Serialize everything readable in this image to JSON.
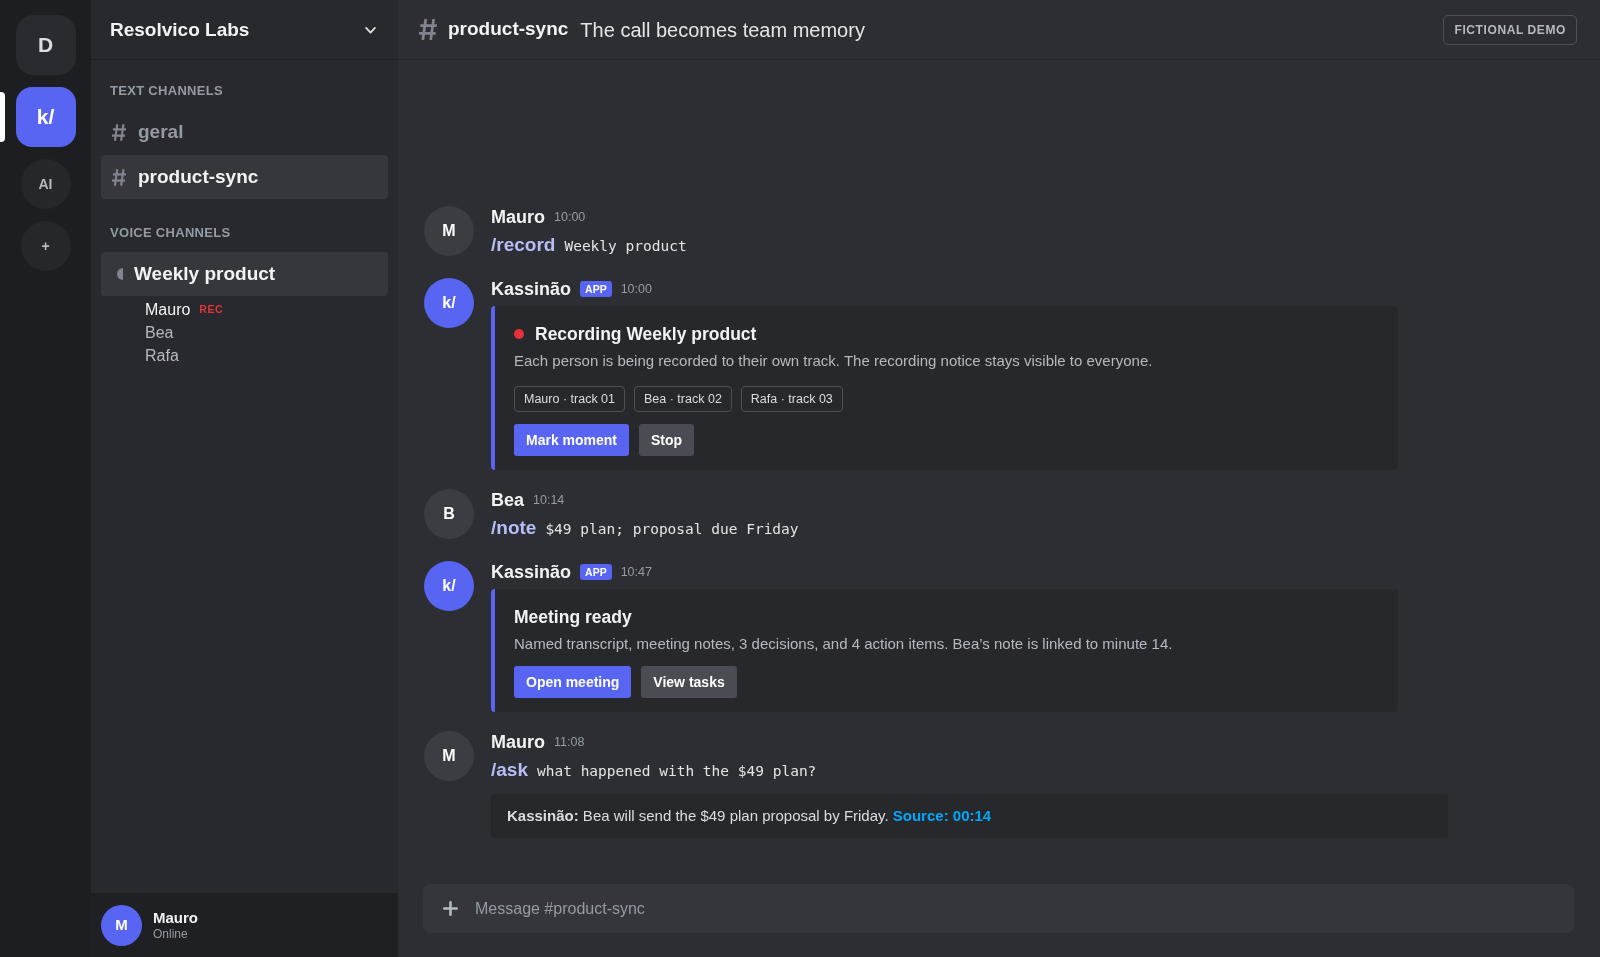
{
  "servers": [
    {
      "label": "D",
      "kind": "server",
      "selected": false
    },
    {
      "label": "k/",
      "kind": "server",
      "selected": true
    },
    {
      "label": "AI",
      "kind": "app",
      "selected": false
    },
    {
      "label": "+",
      "kind": "add",
      "selected": false
    }
  ],
  "sidebar": {
    "server_name": "Resolvico Labs",
    "groups": [
      {
        "title": "TEXT CHANNELS",
        "kind": "text",
        "channels": [
          {
            "name": "geral",
            "selected": false
          },
          {
            "name": "product-sync",
            "selected": true
          }
        ]
      },
      {
        "title": "VOICE CHANNELS",
        "kind": "voice",
        "channels": [
          {
            "name": "Weekly product",
            "selected": true,
            "members": [
              {
                "name": "Mauro",
                "active": true,
                "badge": "REC"
              },
              {
                "name": "Bea",
                "active": false
              },
              {
                "name": "Rafa",
                "active": false
              }
            ]
          }
        ]
      }
    ],
    "user": {
      "avatar": "M",
      "name": "Mauro",
      "status": "Online"
    }
  },
  "header": {
    "channel": "product-sync",
    "topic": "The call becomes team memory",
    "badge": "FICTIONAL DEMO"
  },
  "messages": [
    {
      "kind": "command",
      "author": "Mauro",
      "avatar": {
        "initials": "M",
        "color": "#3b3d43"
      },
      "time": "10:00",
      "command": "/record",
      "argument": "Weekly product"
    },
    {
      "kind": "embed",
      "author": "Kassinão",
      "avatar": {
        "initials": "k/",
        "color": "#5865f2"
      },
      "tag": "APP",
      "time": "10:00",
      "embed": {
        "live": true,
        "title": "Recording Weekly product",
        "description": "Each person is being recorded to their own track. The recording notice stays visible to everyone.",
        "chips": [
          "Mauro · track 01",
          "Bea · track 02",
          "Rafa · track 03"
        ],
        "buttons": [
          {
            "label": "Mark moment",
            "kind": "primary"
          },
          {
            "label": "Stop",
            "kind": "secondary"
          }
        ]
      }
    },
    {
      "kind": "command",
      "author": "Bea",
      "avatar": {
        "initials": "B",
        "color": "#3b3d43"
      },
      "time": "10:14",
      "command": "/note",
      "argument": "$49 plan; proposal due Friday"
    },
    {
      "kind": "embed",
      "author": "Kassinão",
      "avatar": {
        "initials": "k/",
        "color": "#5865f2"
      },
      "tag": "APP",
      "time": "10:47",
      "embed": {
        "title": "Meeting ready",
        "description": "Named transcript, meeting notes, 3 decisions, and 4 action items. Bea’s note is linked to minute 14.",
        "buttons": [
          {
            "label": "Open meeting",
            "kind": "primary"
          },
          {
            "label": "View tasks",
            "kind": "secondary"
          }
        ]
      }
    },
    {
      "kind": "command",
      "author": "Mauro",
      "avatar": {
        "initials": "M",
        "color": "#3b3d43"
      },
      "time": "11:08",
      "command": "/ask",
      "argument": "what happened with the $49 plan?",
      "reply": {
        "text": "**Kassinão:** Bea will send the $49 plan proposal by Friday.",
        "link": "Source: 00:14"
      }
    }
  ],
  "composer": {
    "placeholder": "Message #product-sync"
  }
}
